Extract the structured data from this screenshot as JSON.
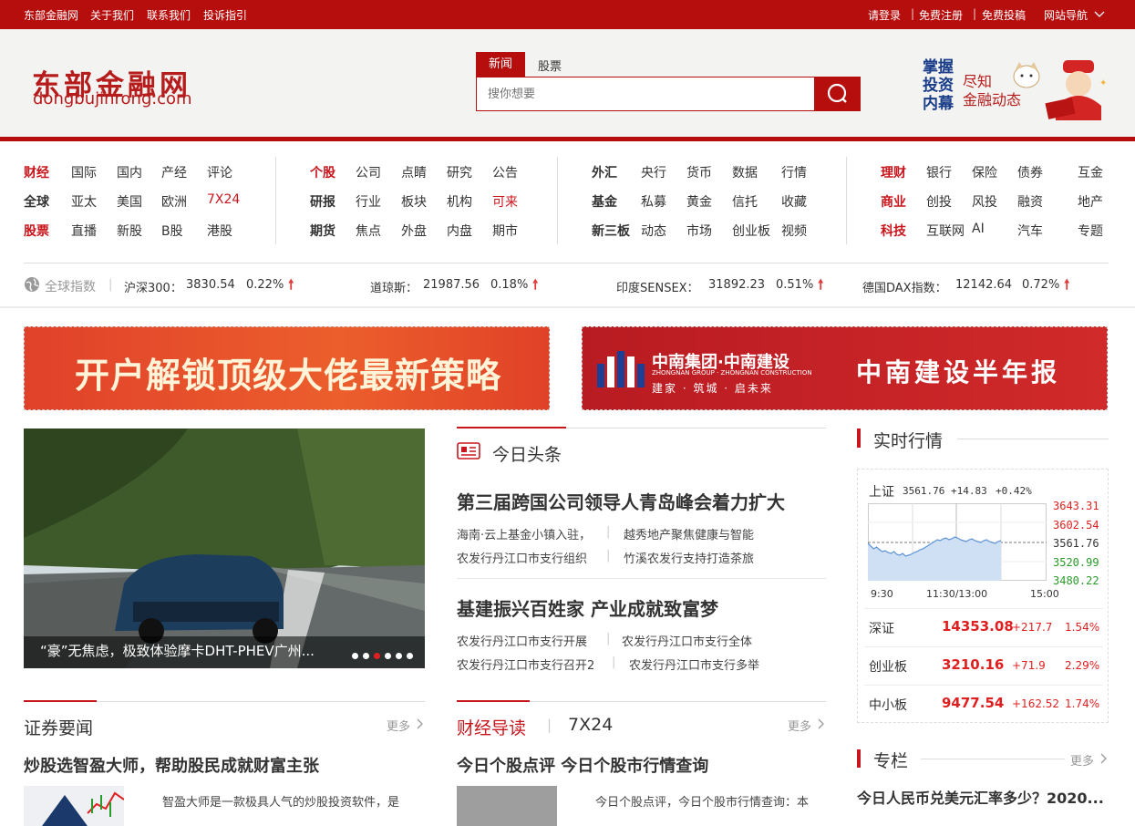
{
  "topbar": {
    "left": [
      "东部金融网",
      "关于我们",
      "联系我们",
      "投诉指引"
    ],
    "login": "请登录",
    "register": "免费注册",
    "contribute": "免费投稿",
    "sitenav": "网站导航"
  },
  "header": {
    "logo_cn": "东部金融网",
    "logo_en": "dongbujinrong.com",
    "search_tabs": [
      "新闻",
      "股票"
    ],
    "search_placeholder": "搜你想要",
    "slogan_left": [
      "掌握",
      "投资",
      "内幕"
    ],
    "slogan_right": [
      "尽知",
      "金融动态"
    ]
  },
  "nav": {
    "g1": [
      [
        "财经",
        "国际",
        "国内",
        "产经",
        "评论"
      ],
      [
        "全球",
        "亚太",
        "美国",
        "欧洲",
        "7X24"
      ],
      [
        "股票",
        "直播",
        "新股",
        "B股",
        "港股"
      ]
    ],
    "g2": [
      [
        "个股",
        "公司",
        "点睛",
        "研究",
        "公告"
      ],
      [
        "研报",
        "行业",
        "板块",
        "机构",
        "可来"
      ],
      [
        "期货",
        "焦点",
        "外盘",
        "内盘",
        "期市"
      ]
    ],
    "g3": [
      [
        "外汇",
        "央行",
        "货币",
        "数据",
        "行情"
      ],
      [
        "基金",
        "私募",
        "黄金",
        "信托",
        "收藏"
      ],
      [
        "新三板",
        "动态",
        "市场",
        "创业板",
        "视频"
      ]
    ],
    "g4": [
      [
        "理财",
        "银行",
        "保险",
        "债券",
        "互金"
      ],
      [
        "商业",
        "创投",
        "风投",
        "融资",
        "地产"
      ],
      [
        "科技",
        "互联网",
        "AI",
        "汽车",
        "专题"
      ]
    ]
  },
  "indices": {
    "label": "全球指数",
    "items": [
      {
        "name": "沪深300：",
        "value": "3830.54",
        "pct": "0.22%"
      },
      {
        "name": "道琼斯：",
        "value": "21987.56",
        "pct": "0.18%"
      },
      {
        "name": "印度SENSEX：",
        "value": "31892.23",
        "pct": "0.51%"
      },
      {
        "name": "德国DAX指数：",
        "value": "12142.64",
        "pct": "0.72%"
      }
    ]
  },
  "banners": {
    "left": "开户解锁顶级大佬最新策略",
    "right_logo": "中南集团·中南建设",
    "right_logo_en": "ZHONGNAN GROUP · ZHONGNAN CONSTRUCTION",
    "right_tag": "建家 · 筑城 · 启未来",
    "right_title": "中南建设半年报"
  },
  "slide": {
    "caption": "“豪”无焦虑，极致体验摩卡DHT-PHEV广州...",
    "dots": 6,
    "active_dot": 2
  },
  "headlines": {
    "title": "今日头条",
    "main1": "第三届跨国公司领导人青岛峰会着力扩大",
    "subs1": [
      [
        "海南·云上基金小镇入驻，",
        "越秀地产聚焦健康与智能"
      ],
      [
        "农发行丹江口市支行组织",
        "竹溪农发行支持打造茶旅"
      ]
    ],
    "main2": "基建振兴百姓家 产业成就致富梦",
    "subs2": [
      [
        "农发行丹江口市支行开展",
        "农发行丹江口市支行全体"
      ],
      [
        "农发行丹江口市支行召开2",
        "农发行丹江口市支行多举"
      ]
    ]
  },
  "realtime": {
    "title": "实时行情",
    "sh_label": "上证",
    "sh_value": "3561.76",
    "sh_change": "+14.83",
    "sh_pct": "+0.42%",
    "y_labels": [
      "3643.31",
      "3602.54",
      "3561.76",
      "3520.99",
      "3480.22"
    ],
    "x_labels": [
      "9:30",
      "11:30/13:00",
      "15:00"
    ],
    "rows": [
      {
        "name": "深证",
        "price": "14353.08",
        "change": "+217.7",
        "pct": "1.54%"
      },
      {
        "name": "创业板",
        "price": "3210.16",
        "change": "+71.9",
        "pct": "2.29%"
      },
      {
        "name": "中小板",
        "price": "9477.54",
        "change": "+162.52",
        "pct": "1.74%"
      }
    ]
  },
  "securities": {
    "title": "证券要闻",
    "more": "更多",
    "headline": "炒股选智盈大师，帮助股民成就财富主张",
    "text": "智盈大师是一款极具人气的炒股投资软件，是"
  },
  "guide": {
    "title": "财经导读",
    "tab2": "7X24",
    "more": "更多",
    "headline": "今日个股点评 今日个股市行情查询",
    "text": "今日个股点评，今日个股市行情查询：本"
  },
  "column": {
    "title": "专栏",
    "more": "更多",
    "headline": "今日人民币兑美元汇率多少？2020..."
  },
  "colors": {
    "brand": "#b60d0d",
    "up": "#e02020"
  }
}
